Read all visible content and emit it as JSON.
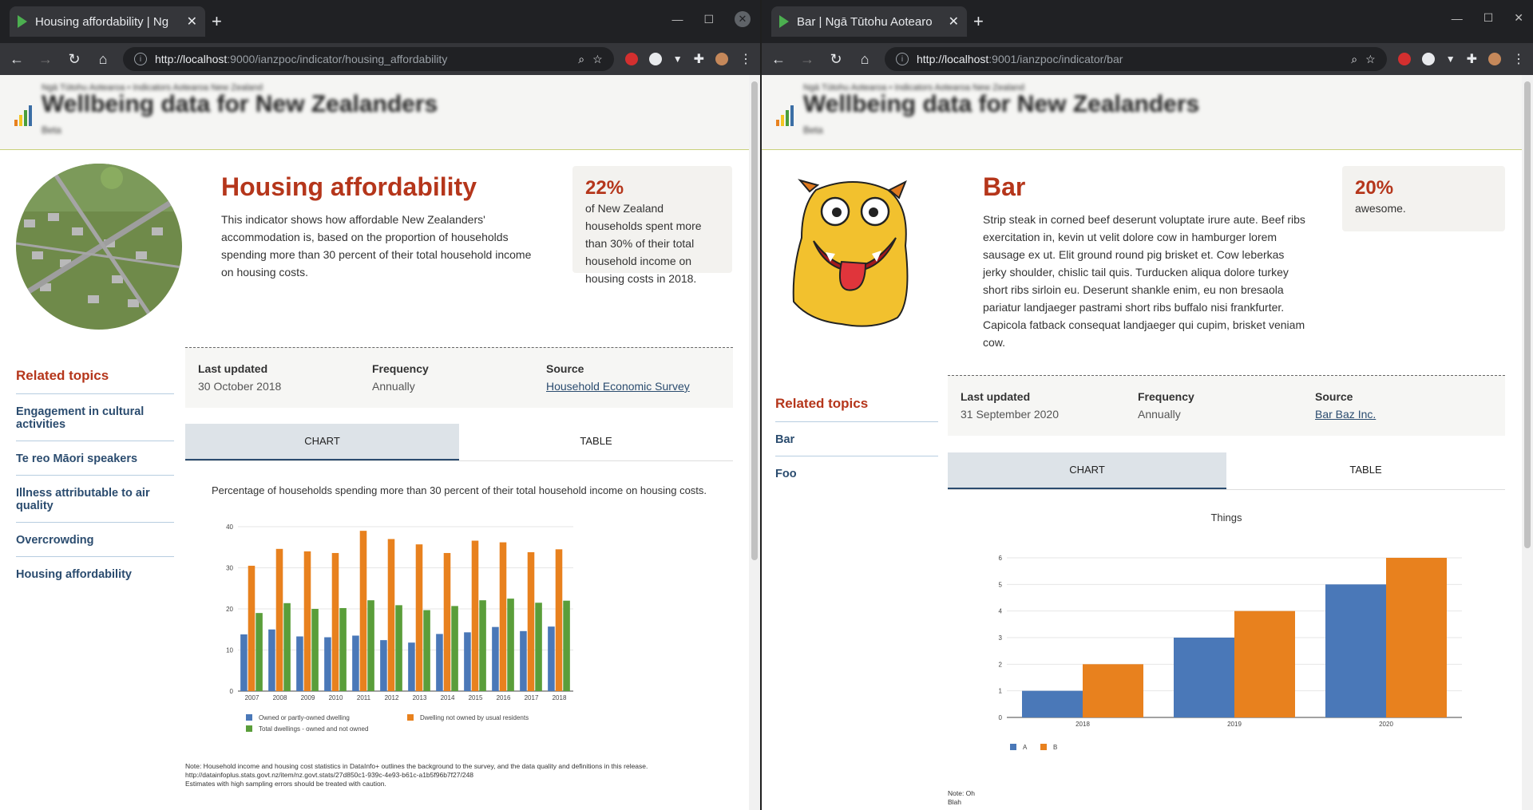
{
  "left": {
    "tab_title": "Housing affordability | Ng",
    "url_host": "http://localhost",
    "url_rest": ":9000/ianzpoc/indicator/housing_affordability",
    "site": {
      "small": "Ngā Tūtohu Aotearoa • Indicators Aotearoa New Zealand",
      "title": "Wellbeing data for New Zealanders",
      "tiny": "Beta"
    },
    "heading": "Housing affordability",
    "description": "This indicator shows how affordable New Zealanders' accommodation is, based on the proportion of households spending more than 30 percent of their total household income on housing costs.",
    "stat_pct": "22%",
    "stat_text": "of New Zealand households spent more than 30% of their total household income on housing costs in 2018.",
    "related_title": "Related topics",
    "related": [
      "Engagement in cultural activities",
      "Te reo Māori speakers",
      "Illness attributable to air quality",
      "Overcrowding",
      "Housing affordability"
    ],
    "meta": {
      "last_updated_label": "Last updated",
      "last_updated": "30 October 2018",
      "frequency_label": "Frequency",
      "frequency": "Annually",
      "source_label": "Source",
      "source": "Household Economic Survey"
    },
    "tabs": [
      "CHART",
      "TABLE"
    ],
    "chart_caption": "Percentage of households spending more than 30 percent of their total household income on housing costs.",
    "note": [
      "Note: Household income and housing cost statistics in DataInfo+ outlines the background to the survey, and the data quality and definitions in this release.",
      "http://datainfoplus.stats.govt.nz/item/nz.govt.stats/27d850c1-939c-4e93-b61c-a1b5f96b7f27/248",
      "Estimates with high sampling errors should be treated with caution."
    ]
  },
  "right": {
    "tab_title": "Bar | Ngā Tūtohu Aotearo",
    "url_host": "http://localhost",
    "url_rest": ":9001/ianzpoc/indicator/bar",
    "site": {
      "small": "Ngā Tūtohu Aotearoa • Indicators Aotearoa New Zealand",
      "title": "Wellbeing data for New Zealanders",
      "tiny": "Beta"
    },
    "heading": "Bar",
    "description": "Strip steak in corned beef deserunt voluptate irure aute. Beef ribs exercitation in, kevin ut velit dolore cow in hamburger lorem sausage ex ut. Elit ground round pig brisket et. Cow leberkas jerky shoulder, chislic tail quis. Turducken aliqua dolore turkey short ribs sirloin eu. Deserunt shankle enim, eu non bresaola pariatur landjaeger pastrami short ribs buffalo nisi frankfurter. Capicola fatback consequat landjaeger qui cupim, brisket veniam cow.",
    "stat_pct": "20%",
    "stat_text": "awesome.",
    "related_title": "Related topics",
    "related": [
      "Bar",
      "Foo"
    ],
    "meta": {
      "last_updated_label": "Last updated",
      "last_updated": "31 September 2020",
      "frequency_label": "Frequency",
      "frequency": "Annually",
      "source_label": "Source",
      "source": "Bar Baz Inc."
    },
    "tabs": [
      "CHART",
      "TABLE"
    ],
    "chart_caption": "Things",
    "note": [
      "Note: Oh",
      "Blah"
    ]
  },
  "colors": {
    "accent": "#b5361b",
    "link": "#2b4c6f",
    "blue": "#4a78b8",
    "orange": "#e8811e",
    "green": "#5a9e3a"
  },
  "chart_data": [
    {
      "type": "bar",
      "title": "",
      "categories": [
        "2007",
        "2008",
        "2009",
        "2010",
        "2011",
        "2012",
        "2013",
        "2014",
        "2015",
        "2016",
        "2017",
        "2018"
      ],
      "series": [
        {
          "name": "Owned or partly-owned dwelling",
          "values": [
            13.8,
            15,
            13.3,
            13.1,
            13.5,
            12.4,
            11.8,
            13.9,
            14.3,
            15.6,
            14.6,
            15.7
          ]
        },
        {
          "name": "Dwelling not owned by usual residents",
          "values": [
            30.5,
            34.6,
            34,
            33.6,
            39,
            37,
            35.7,
            33.6,
            36.6,
            36.2,
            33.8,
            34.5
          ]
        },
        {
          "name": "Total dwellings - owned and not owned",
          "values": [
            19,
            21.4,
            20,
            20.2,
            22.1,
            20.9,
            19.7,
            20.7,
            22.1,
            22.5,
            21.5,
            22
          ]
        }
      ],
      "ylim": [
        0,
        40
      ],
      "yticks": [
        0,
        10,
        20,
        30,
        40
      ],
      "grid": true,
      "legend": "bottom"
    },
    {
      "type": "bar",
      "title": "Things",
      "categories": [
        "2018",
        "2019",
        "2020"
      ],
      "series": [
        {
          "name": "A",
          "values": [
            1,
            3,
            5
          ]
        },
        {
          "name": "B",
          "values": [
            2,
            4,
            6
          ]
        }
      ],
      "ylim": [
        0,
        6
      ],
      "yticks": [
        0,
        1,
        2,
        3,
        4,
        5,
        6
      ],
      "grid": true,
      "legend": "bottom"
    }
  ]
}
